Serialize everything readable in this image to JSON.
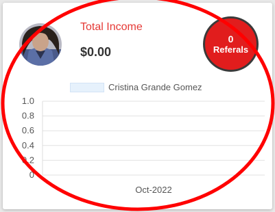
{
  "card": {
    "income_label": "Total Income",
    "income_value": "$0.00",
    "referrals_count": "0",
    "referrals_label": "Referals"
  },
  "avatar": {
    "icon": "profile-photo"
  },
  "colors": {
    "accent_red": "#e53935",
    "badge_red": "#e11d1d",
    "annotation_red": "#ff0000",
    "legend_fill": "#e6f1fc"
  },
  "chart_data": {
    "type": "bar",
    "categories": [
      "Oct-2022"
    ],
    "series": [
      {
        "name": "Cristina Grande Gomez",
        "values": [
          0
        ]
      }
    ],
    "y_ticks": [
      "1.0",
      "0.8",
      "0.6",
      "0.4",
      "0.2",
      "0"
    ],
    "ylim": [
      0,
      1
    ],
    "grid": true,
    "legend": "top"
  }
}
